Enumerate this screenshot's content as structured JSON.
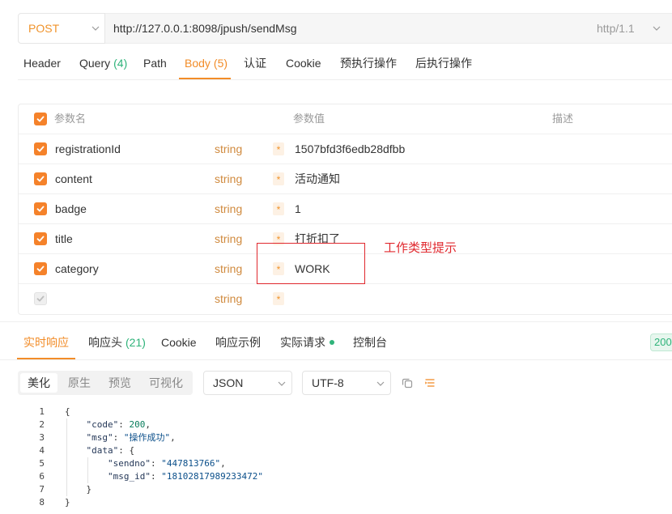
{
  "request": {
    "method": "POST",
    "url": "http://127.0.0.1:8098/jpush/sendMsg",
    "protocol": "http/1.1"
  },
  "request_tabs": {
    "header": {
      "label": "Header",
      "active": false
    },
    "query": {
      "label": "Query",
      "count": "(4)",
      "active": false
    },
    "path": {
      "label": "Path",
      "active": false
    },
    "body": {
      "label": "Body",
      "count": "(5)",
      "active": true
    },
    "auth": {
      "label": "认证",
      "active": false
    },
    "cookie": {
      "label": "Cookie",
      "active": false
    },
    "pre_script": {
      "label": "预执行操作",
      "active": false
    },
    "post_script": {
      "label": "后执行操作",
      "active": false
    }
  },
  "params_table": {
    "header": {
      "all_checked": true,
      "name": "参数名",
      "value": "参数值",
      "description": "描述"
    },
    "rows": [
      {
        "checked": true,
        "placeholder": false,
        "name": "registrationId",
        "type": "string",
        "required": "*",
        "value": "1507bfd3f6edb28dfbb"
      },
      {
        "checked": true,
        "placeholder": false,
        "name": "content",
        "type": "string",
        "required": "*",
        "value": "活动通知"
      },
      {
        "checked": true,
        "placeholder": false,
        "name": "badge",
        "type": "string",
        "required": "*",
        "value": "1"
      },
      {
        "checked": true,
        "placeholder": false,
        "name": "title",
        "type": "string",
        "required": "*",
        "value": "打折扣了"
      },
      {
        "checked": true,
        "placeholder": false,
        "name": "category",
        "type": "string",
        "required": "*",
        "value": "WORK"
      },
      {
        "checked": false,
        "placeholder": true,
        "name": "",
        "type": "string",
        "required": "*",
        "value": ""
      }
    ]
  },
  "annotation": {
    "text": "工作类型提示",
    "color": "#e0282e"
  },
  "response": {
    "tabs": {
      "live": {
        "label": "实时响应",
        "active": true
      },
      "headers": {
        "label": "响应头",
        "count": "(21)",
        "active": false
      },
      "cookie": {
        "label": "Cookie",
        "active": false
      },
      "example": {
        "label": "响应示例",
        "active": false
      },
      "actual_request": {
        "label": "实际请求",
        "active": false
      },
      "console": {
        "label": "控制台",
        "active": false
      }
    },
    "status_code": "200"
  },
  "response_toolbar": {
    "view_modes": [
      {
        "label": "美化",
        "active": true
      },
      {
        "label": "原生",
        "active": false
      },
      {
        "label": "预览",
        "active": false
      },
      {
        "label": "可视化",
        "active": false
      }
    ],
    "format": "JSON",
    "encoding": "UTF-8"
  },
  "response_body": {
    "line_numbers": [
      "1",
      "2",
      "3",
      "4",
      "5",
      "6",
      "7",
      "8"
    ],
    "lines": [
      {
        "tokens": [
          {
            "type": "punct",
            "text": "{"
          }
        ]
      },
      {
        "tokens": [
          {
            "type": "ws",
            "text": "    "
          },
          {
            "type": "key",
            "text": "\"code\""
          },
          {
            "type": "punct",
            "text": ": "
          },
          {
            "type": "num",
            "text": "200"
          },
          {
            "type": "punct",
            "text": ","
          }
        ]
      },
      {
        "tokens": [
          {
            "type": "ws",
            "text": "    "
          },
          {
            "type": "key",
            "text": "\"msg\""
          },
          {
            "type": "punct",
            "text": ": "
          },
          {
            "type": "str",
            "text": "\"操作成功\""
          },
          {
            "type": "punct",
            "text": ","
          }
        ]
      },
      {
        "tokens": [
          {
            "type": "ws",
            "text": "    "
          },
          {
            "type": "key",
            "text": "\"data\""
          },
          {
            "type": "punct",
            "text": ": {"
          }
        ]
      },
      {
        "tokens": [
          {
            "type": "ws",
            "text": "        "
          },
          {
            "type": "key",
            "text": "\"sendno\""
          },
          {
            "type": "punct",
            "text": ": "
          },
          {
            "type": "str",
            "text": "\"447813766\""
          },
          {
            "type": "punct",
            "text": ","
          }
        ]
      },
      {
        "tokens": [
          {
            "type": "ws",
            "text": "        "
          },
          {
            "type": "key",
            "text": "\"msg_id\""
          },
          {
            "type": "punct",
            "text": ": "
          },
          {
            "type": "str",
            "text": "\"18102817989233472\""
          }
        ]
      },
      {
        "tokens": [
          {
            "type": "ws",
            "text": "    "
          },
          {
            "type": "punct",
            "text": "}"
          }
        ]
      },
      {
        "tokens": [
          {
            "type": "punct",
            "text": "}"
          }
        ]
      }
    ]
  },
  "colors": {
    "accent": "#f28c28",
    "success": "#2fb37a",
    "annotation": "#e0282e",
    "type_label": "#d08a3e"
  },
  "icons": {
    "method_dropdown": "chevron-down-icon",
    "protocol_dropdown": "chevron-down-icon",
    "checkbox": "check-icon",
    "copy": "copy-icon",
    "format": "format-icon",
    "request_sent": "status-dot-icon"
  }
}
